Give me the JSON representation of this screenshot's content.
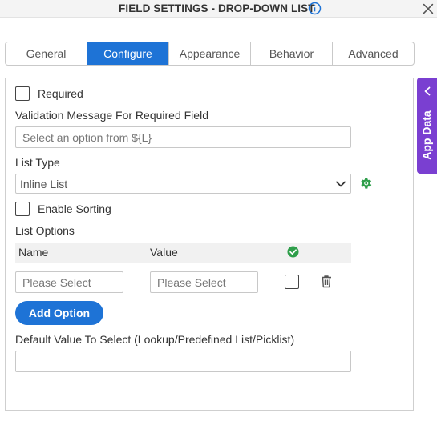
{
  "header": {
    "title": "FIELD SETTINGS - DROP-DOWN LIST",
    "info_icon": "info-icon",
    "close_icon": "close-icon"
  },
  "tabs": [
    {
      "label": "General",
      "active": false
    },
    {
      "label": "Configure",
      "active": true
    },
    {
      "label": "Appearance",
      "active": false
    },
    {
      "label": "Behavior",
      "active": false
    },
    {
      "label": "Advanced",
      "active": false
    }
  ],
  "form": {
    "required_label": "Required",
    "required_checked": false,
    "validation_label": "Validation Message For Required Field",
    "validation_placeholder": "Select an option from ${L}",
    "list_type_label": "List Type",
    "list_type_value": "Inline List",
    "enable_sorting_label": "Enable Sorting",
    "enable_sorting_checked": false,
    "list_options_label": "List Options",
    "columns": {
      "name": "Name",
      "value": "Value"
    },
    "row": {
      "name_placeholder": "Please Select",
      "value_placeholder": "Please Select",
      "default_checked": false
    },
    "add_option_label": "Add Option",
    "default_value_label": "Default Value To Select (Lookup/Predefined List/Picklist)",
    "default_value": ""
  },
  "side_panel": {
    "label": "App Data",
    "icon": "chevron-left-icon"
  },
  "colors": {
    "accent": "#1e73d6",
    "side_panel": "#7a3fd1",
    "success": "#2e9e4a"
  }
}
